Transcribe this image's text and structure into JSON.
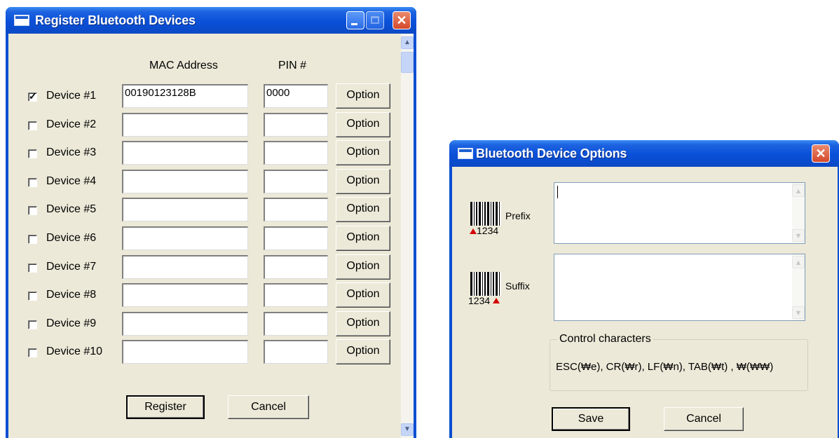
{
  "register_window": {
    "title": "Register Bluetooth Devices",
    "col_mac": "MAC Address",
    "col_pin": "PIN #",
    "devices": [
      {
        "label": "Device #1",
        "checked": true,
        "mac": "00190123128B",
        "pin": "0000",
        "option": "Option"
      },
      {
        "label": "Device #2",
        "checked": false,
        "mac": "",
        "pin": "",
        "option": "Option"
      },
      {
        "label": "Device #3",
        "checked": false,
        "mac": "",
        "pin": "",
        "option": "Option"
      },
      {
        "label": "Device #4",
        "checked": false,
        "mac": "",
        "pin": "",
        "option": "Option"
      },
      {
        "label": "Device #5",
        "checked": false,
        "mac": "",
        "pin": "",
        "option": "Option"
      },
      {
        "label": "Device #6",
        "checked": false,
        "mac": "",
        "pin": "",
        "option": "Option"
      },
      {
        "label": "Device #7",
        "checked": false,
        "mac": "",
        "pin": "",
        "option": "Option"
      },
      {
        "label": "Device #8",
        "checked": false,
        "mac": "",
        "pin": "",
        "option": "Option"
      },
      {
        "label": "Device #9",
        "checked": false,
        "mac": "",
        "pin": "",
        "option": "Option"
      },
      {
        "label": "Device #10",
        "checked": false,
        "mac": "",
        "pin": "",
        "option": "Option"
      }
    ],
    "register_label": "Register",
    "cancel_label": "Cancel"
  },
  "options_window": {
    "title": "Bluetooth Device Options",
    "prefix_label": "Prefix",
    "prefix_code": "1234",
    "prefix_value": "",
    "suffix_label": "Suffix",
    "suffix_code": "1234",
    "suffix_value": "",
    "control_title": "Control characters",
    "control_text": "ESC(₩e), CR(₩r), LF(₩n), TAB(₩t) , ₩(₩₩)",
    "save_label": "Save",
    "cancel_label": "Cancel"
  },
  "colors": {
    "titlebar": "#0a50d8",
    "dialog_face": "#ece9d8",
    "close_button": "#d4482a",
    "marker_red": "#d40000"
  },
  "icons": [
    "window-icon",
    "minimize-icon",
    "maximize-icon",
    "close-icon",
    "barcode-icon",
    "mouse-cursor-icon"
  ]
}
